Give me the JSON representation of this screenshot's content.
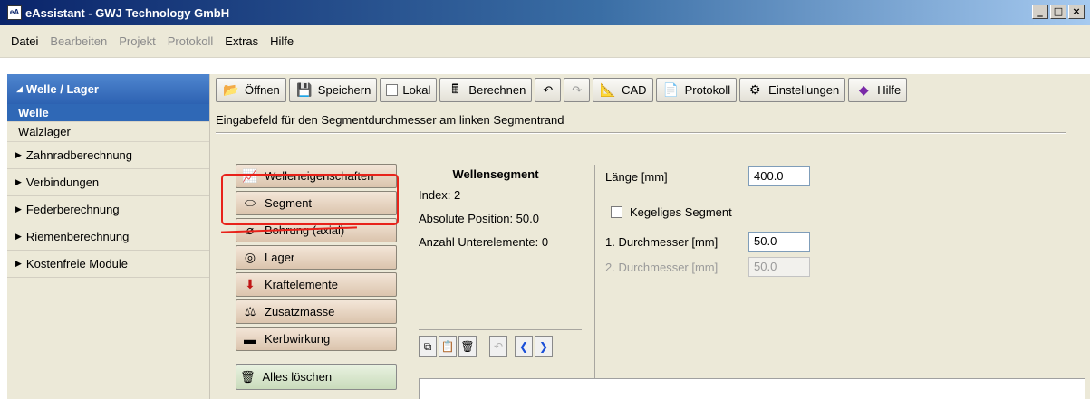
{
  "window": {
    "title": "eAssistant - GWJ Technology GmbH",
    "icon_text": "eA",
    "buttons": [
      "_",
      "□",
      "×"
    ]
  },
  "menu": [
    {
      "label": "Datei",
      "enabled": true
    },
    {
      "label": "Bearbeiten",
      "enabled": false
    },
    {
      "label": "Projekt",
      "enabled": false
    },
    {
      "label": "Protokoll",
      "enabled": false
    },
    {
      "label": "Extras",
      "enabled": true
    },
    {
      "label": "Hilfe",
      "enabled": true
    }
  ],
  "sidebar": {
    "section": "Welle / Lager",
    "subitems": [
      "Welle",
      "Wälzlager"
    ],
    "items": [
      "Zahnradberechnung",
      "Verbindungen",
      "Federberechnung",
      "Riemenberechnung",
      "Kostenfreie Module"
    ]
  },
  "toolbar": {
    "open": "Öffnen",
    "save": "Speichern",
    "local": "Lokal",
    "calculate": "Berechnen",
    "cad": "CAD",
    "protocol": "Protokoll",
    "settings": "Einstellungen",
    "help": "Hilfe"
  },
  "hint": "Eingabefeld für den Segmentdurchmesser am linken Segmentrand",
  "segment_buttons": [
    "Welleneigenschaften",
    "Segment",
    "Bohrung (axial)",
    "Lager",
    "Kraftelemente",
    "Zusatzmasse",
    "Kerbwirkung"
  ],
  "clear_all": "Alles löschen",
  "segment": {
    "title": "Wellensegment",
    "index": "Index: 2",
    "abs_position": "Absolute Position:  50.0",
    "sub_elements": "Anzahl Unterelemente: 0"
  },
  "form": {
    "length_label": "Länge [mm]",
    "length_value": "400.0",
    "conical_label": "Kegeliges Segment",
    "d1_label": "1. Durchmesser [mm]",
    "d1_value": "50.0",
    "d2_label": "2. Durchmesser [mm]",
    "d2_value": "50.0"
  },
  "colors": {
    "title_bar": "#0a246a",
    "sidebar_active": "#2f68b6",
    "annotation": "#e8221a",
    "segment_button": "#e6d2be"
  }
}
